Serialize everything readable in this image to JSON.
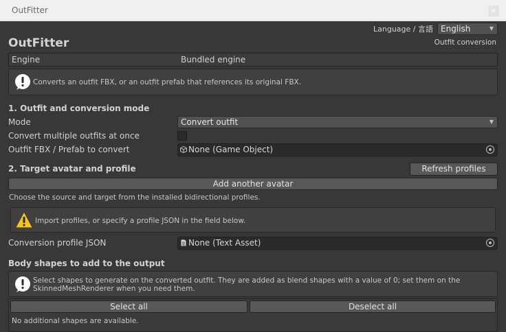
{
  "window": {
    "title": "OutFitter",
    "close_glyph": "×"
  },
  "header": {
    "language_label": "Language / 言語",
    "language_value": "English",
    "app_title": "OutFitter",
    "mode_caption": "Outfit conversion"
  },
  "engine": {
    "label": "Engine",
    "value": "Bundled engine"
  },
  "intro_help": {
    "icon": "info-icon",
    "text": "Converts an outfit FBX, or an outfit prefab that references its original FBX."
  },
  "section1": {
    "title": "1. Outfit and conversion mode",
    "mode_label": "Mode",
    "mode_value": "Convert outfit",
    "multi_label": "Convert multiple outfits at once",
    "multi_checked": false,
    "source_label": "Outfit FBX / Prefab to convert",
    "source_value": "None (Game Object)"
  },
  "section2": {
    "title": "2. Target avatar and profile",
    "refresh_label": "Refresh profiles",
    "add_avatar_label": "Add another avatar",
    "description": "Choose the source and target from the installed bidirectional profiles.",
    "warning": {
      "icon": "warning-icon",
      "text": "Import profiles, or specify a profile JSON in the field below."
    },
    "profile_label": "Conversion profile JSON",
    "profile_value": "None (Text Asset)"
  },
  "body_shapes": {
    "title": "Body shapes to add to the output",
    "help_line1": "Select shapes to generate on the converted outfit. They are added as blend shapes with a value of 0; set them on the",
    "help_line2": "SkinnedMeshRenderer when you need them.",
    "select_all_label": "Select all",
    "deselect_all_label": "Deselect all",
    "empty_text": "No additional shapes are available."
  },
  "colors": {
    "panel": "#383838",
    "field": "#2a2a2a",
    "button": "#585858",
    "warning": "#f5c518"
  }
}
